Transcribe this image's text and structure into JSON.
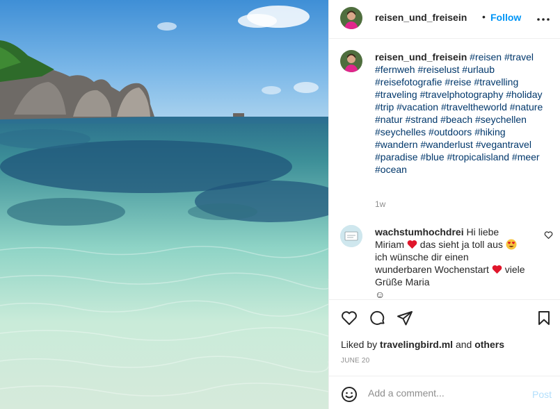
{
  "post": {
    "username": "reisen_und_freisein",
    "follow_label": "Follow",
    "separator": "•",
    "caption_hashtags": "#reisen #travel #fernweh #reiselust #urlaub #reisefotografie #reise #travelling #traveling #travelphotography #holiday #trip #vacation #traveltheworld #nature #natur #strand #beach #seychellen #seychelles #outdoors #hiking #wandern #wanderlust #vegantravel #paradise #blue #tropicalisland #meer #ocean",
    "caption_time": "1w",
    "liked_by_prefix": "Liked by",
    "liked_by_user": "travelingbird.ml",
    "liked_by_and": "and",
    "liked_by_others": "others",
    "date": "JUNE 20"
  },
  "comment": {
    "username": "wachstumhochdrei",
    "part1": "Hi liebe Miriam",
    "part2": "das sieht ja toll aus",
    "part3": "ich wünsche dir einen wunderbaren Wochenstart",
    "part4": "viele Grüße Maria",
    "part5": "☺"
  },
  "composer": {
    "placeholder": "Add a comment...",
    "post_label": "Post"
  },
  "icons": {
    "more": "more-options-icon",
    "like": "heart-icon",
    "comment": "comment-bubble-icon",
    "share": "paper-plane-icon",
    "save": "bookmark-icon",
    "emoji": "smiley-icon"
  },
  "colors": {
    "follow": "#0095f6",
    "hashtag": "#00376b",
    "muted": "#8e8e8e",
    "post_disabled": "#b2dffc",
    "heart_emoji": "#e0162b"
  }
}
